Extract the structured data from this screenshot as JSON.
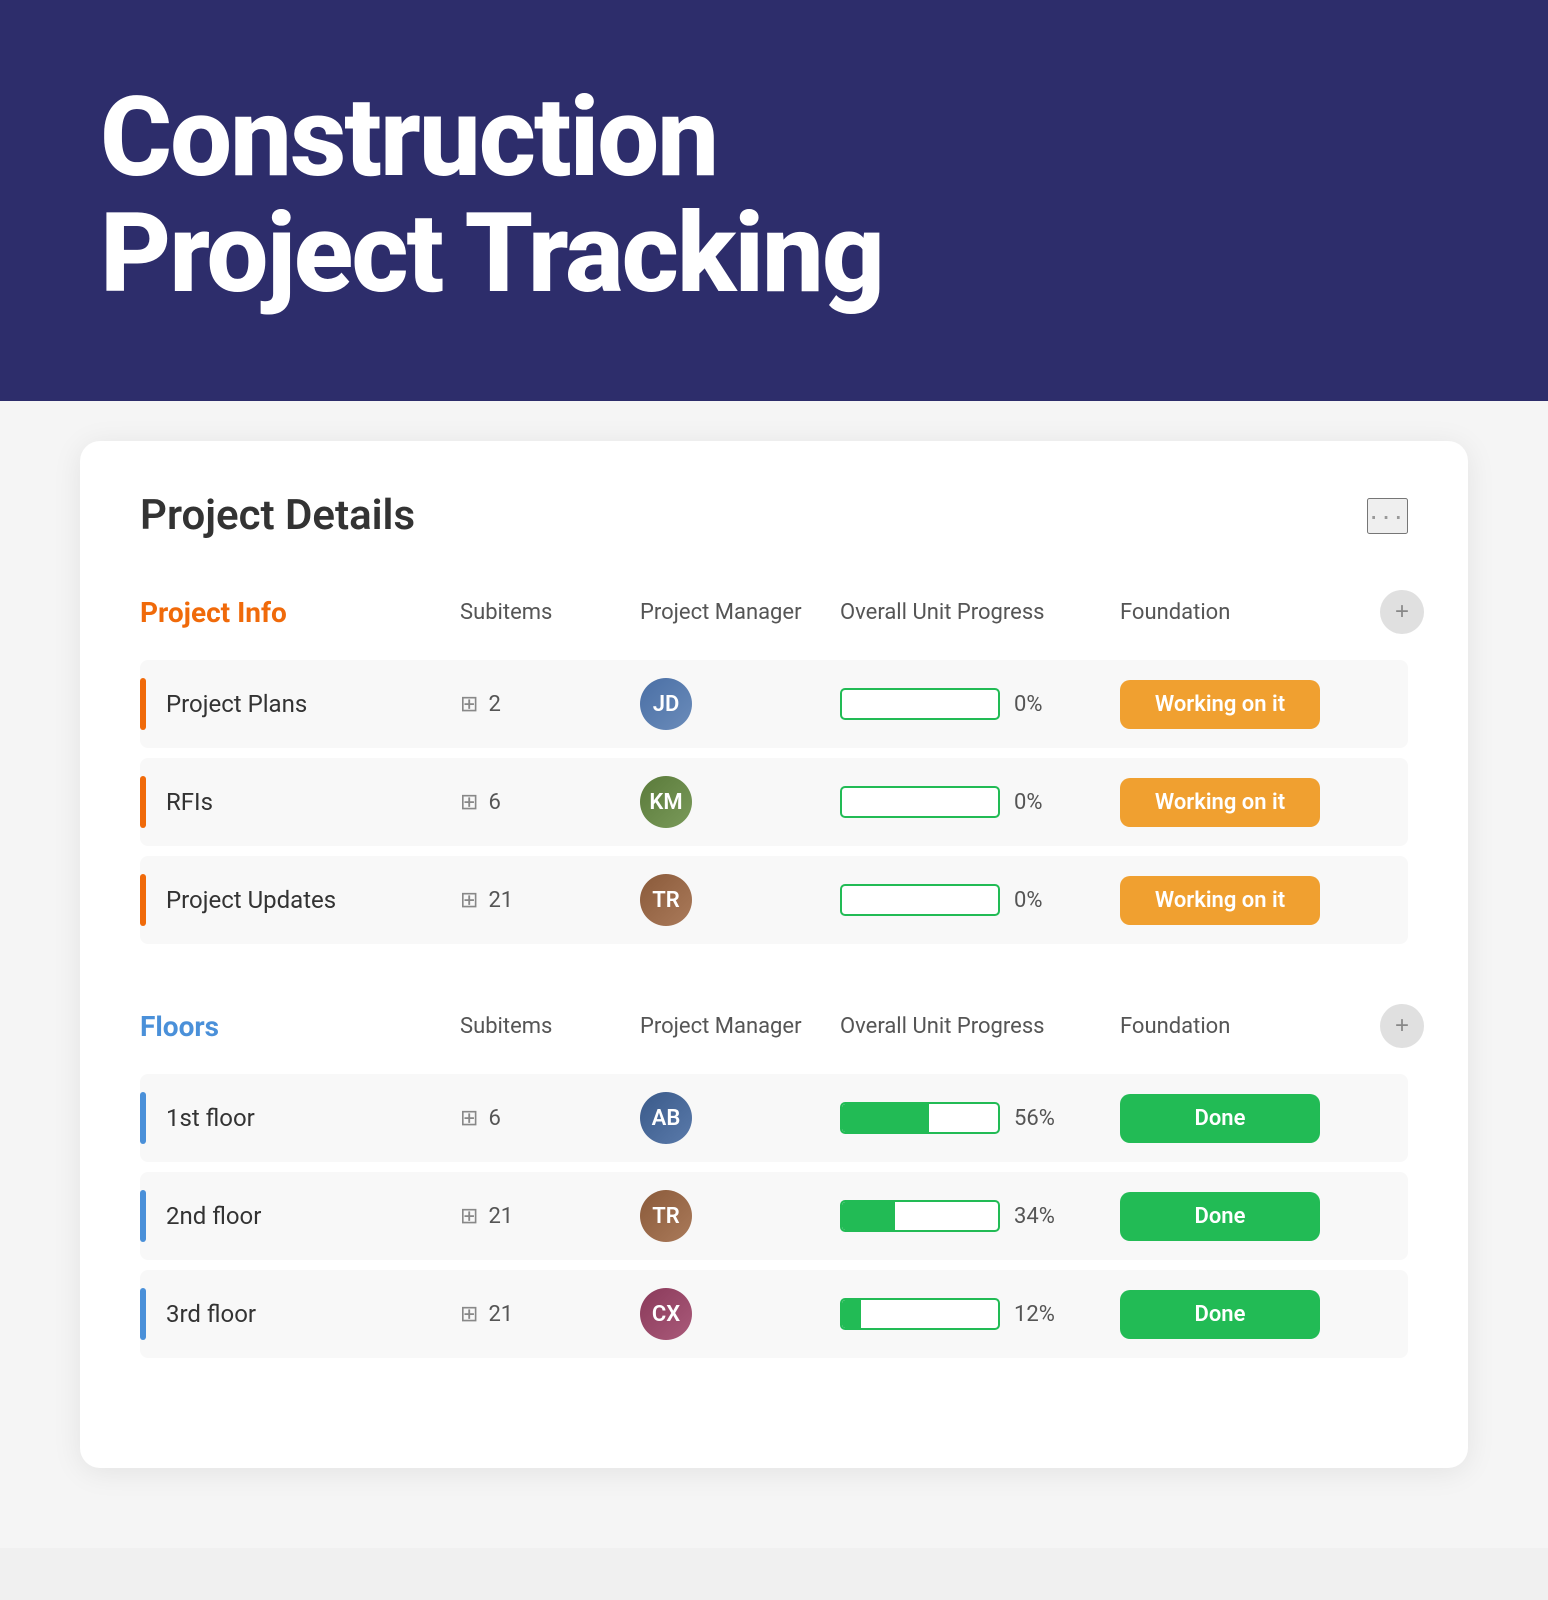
{
  "hero": {
    "title_line1": "Construction",
    "title_line2": "Project Tracking"
  },
  "card": {
    "title": "Project Details",
    "more_icon": "···"
  },
  "project_info": {
    "section_label": "Project Info",
    "col_subitems": "Subitems",
    "col_manager": "Project Manager",
    "col_progress": "Overall Unit Progress",
    "col_status": "Foundation",
    "rows": [
      {
        "name": "Project Plans",
        "subitems": 2,
        "manager_initials": "JD",
        "avatar_class": "avatar-1",
        "progress_pct": 0,
        "progress_display": "0%",
        "status": "Working on it",
        "status_class": "working"
      },
      {
        "name": "RFIs",
        "subitems": 6,
        "manager_initials": "KM",
        "avatar_class": "avatar-2",
        "progress_pct": 0,
        "progress_display": "0%",
        "status": "Working on it",
        "status_class": "working"
      },
      {
        "name": "Project Updates",
        "subitems": 21,
        "manager_initials": "TR",
        "avatar_class": "avatar-3",
        "progress_pct": 0,
        "progress_display": "0%",
        "status": "Working on it",
        "status_class": "working"
      }
    ]
  },
  "floors": {
    "section_label": "Floors",
    "col_subitems": "Subitems",
    "col_manager": "Project Manager",
    "col_progress": "Overall Unit Progress",
    "col_status": "Foundation",
    "rows": [
      {
        "name": "1st floor",
        "subitems": 6,
        "manager_initials": "AB",
        "avatar_class": "avatar-4",
        "progress_pct": 56,
        "progress_display": "56%",
        "status": "Done",
        "status_class": "done"
      },
      {
        "name": "2nd floor",
        "subitems": 21,
        "manager_initials": "TR",
        "avatar_class": "avatar-3",
        "progress_pct": 34,
        "progress_display": "34%",
        "status": "Done",
        "status_class": "done"
      },
      {
        "name": "3rd floor",
        "subitems": 21,
        "manager_initials": "CX",
        "avatar_class": "avatar-5",
        "progress_pct": 12,
        "progress_display": "12%",
        "status": "Done",
        "status_class": "done"
      }
    ]
  }
}
